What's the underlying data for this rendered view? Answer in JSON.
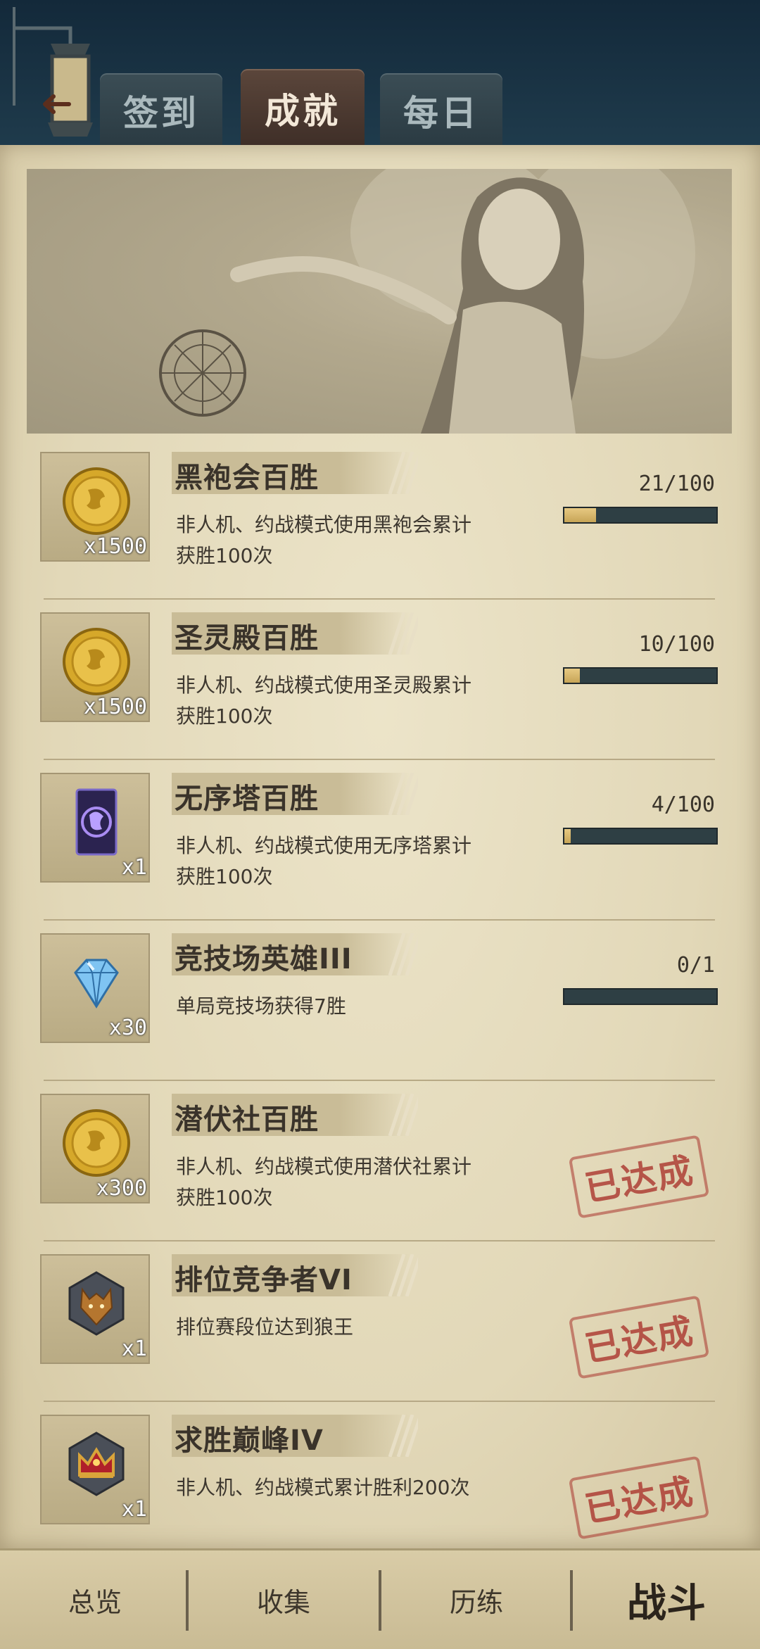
{
  "header": {
    "back_icon": "back-arrow-icon",
    "tabs": [
      {
        "label": "签到",
        "active": false
      },
      {
        "label": "成就",
        "active": true
      },
      {
        "label": "每日",
        "active": false
      }
    ]
  },
  "achievements": [
    {
      "title": "黑袍会百胜",
      "desc": "非人机、约战模式使用黑袍会累计获胜100次",
      "reward_icon": "gold-coin-icon",
      "reward_qty": "x1500",
      "progress_text": "21/100",
      "progress": 0.21,
      "completed": false
    },
    {
      "title": "圣灵殿百胜",
      "desc": "非人机、约战模式使用圣灵殿累计获胜100次",
      "reward_icon": "gold-coin-icon",
      "reward_qty": "x1500",
      "progress_text": "10/100",
      "progress": 0.1,
      "completed": false
    },
    {
      "title": "无序塔百胜",
      "desc": "非人机、约战模式使用无序塔累计获胜100次",
      "reward_icon": "card-back-icon",
      "reward_qty": "x1",
      "progress_text": "4/100",
      "progress": 0.04,
      "completed": false
    },
    {
      "title": "竞技场英雄III",
      "desc": "单局竞技场获得7胜",
      "reward_icon": "diamond-icon",
      "reward_qty": "x30",
      "progress_text": "0/1",
      "progress": 0,
      "completed": false
    },
    {
      "title": "潜伏社百胜",
      "desc": "非人机、约战模式使用潜伏社累计获胜100次",
      "reward_icon": "gold-coin-icon",
      "reward_qty": "x300",
      "completed": true,
      "stamp": "已达成"
    },
    {
      "title": "排位竞争者VI",
      "desc": "排位赛段位达到狼王",
      "reward_icon": "wolf-emblem-icon",
      "reward_qty": "x1",
      "completed": true,
      "stamp": "已达成"
    },
    {
      "title": "求胜巅峰IV",
      "desc": "非人机、约战模式累计胜利200次",
      "reward_icon": "crown-icon",
      "reward_qty": "x1",
      "completed": true,
      "stamp": "已达成"
    }
  ],
  "bottom_nav": [
    {
      "label": "总览"
    },
    {
      "label": "收集"
    },
    {
      "label": "历练"
    },
    {
      "label": "战斗",
      "active": true
    }
  ],
  "colors": {
    "progress_fill": "#d9b86a",
    "progress_track": "#2e3f44",
    "stamp": "#aa342d",
    "tab_active": "#4e3b32"
  }
}
